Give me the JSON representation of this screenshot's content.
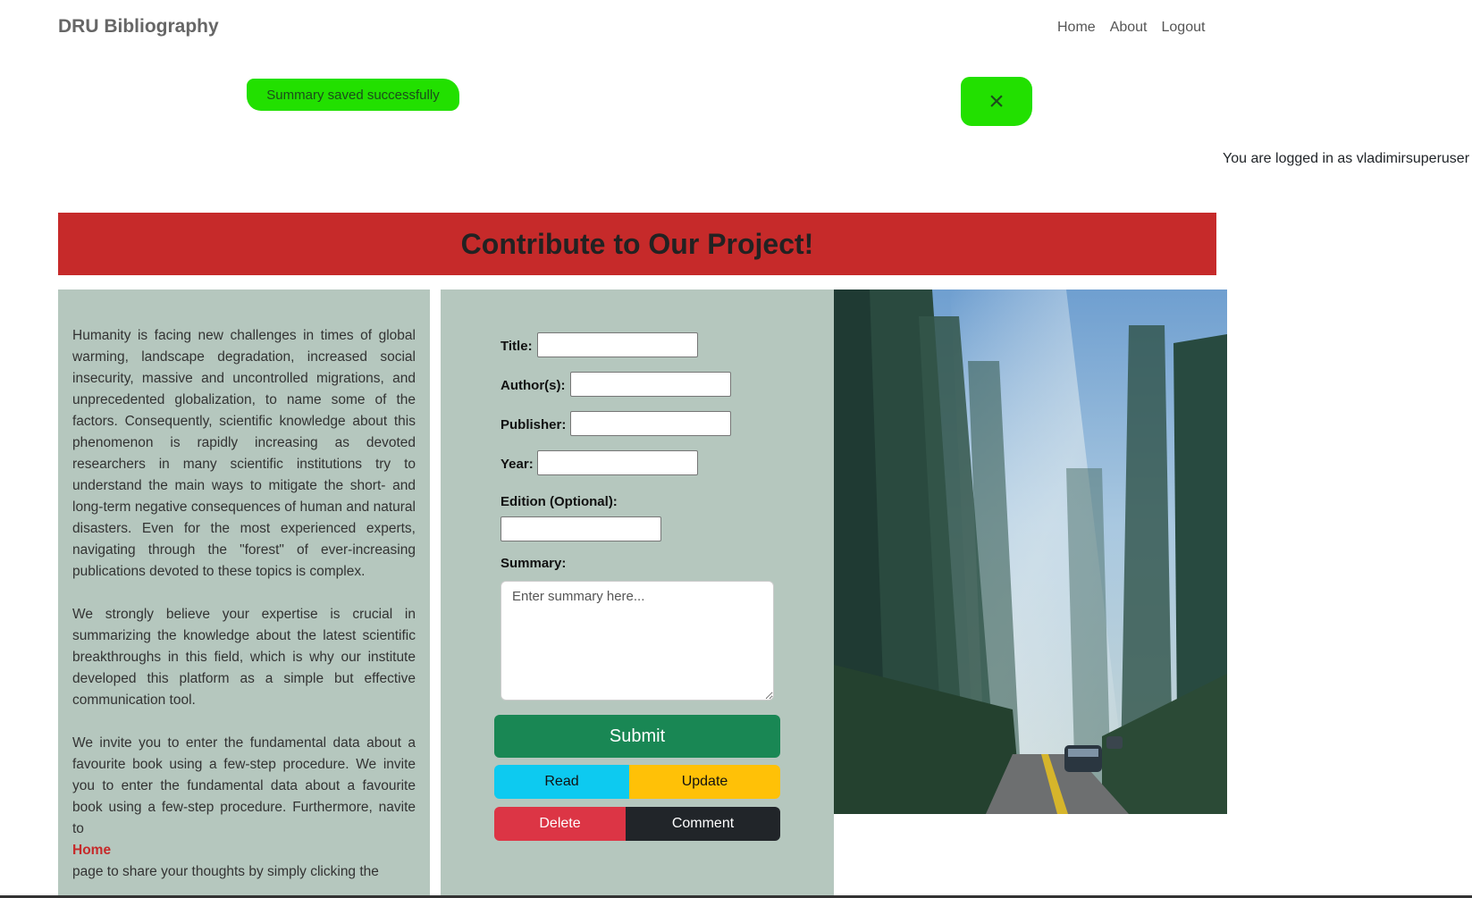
{
  "header": {
    "brand": "DRU Bibliography",
    "nav": [
      "Home",
      "About",
      "Logout"
    ]
  },
  "alert": {
    "message": "Summary saved successfully",
    "close_glyph": "×"
  },
  "login_status": "You are logged in as vladimirsuperuser",
  "banner": {
    "title": "Contribute to Our Project!",
    "color": "#c62a2a"
  },
  "intro": {
    "paragraphs": [
      "Humanity is facing new challenges in times of global warming, landscape degradation, increased social insecurity, massive and uncontrolled migrations, and unprecedented globalization, to name some of the factors. Consequently, scientific knowledge about this phenomenon is rapidly increasing as devoted researchers in many scientific institutions try to understand the main ways to mitigate the short- and long-term negative consequences of human and natural disasters. Even for the most experienced experts, navigating through the \"forest\" of ever-increasing publications devoted to these topics is complex.",
      "We strongly believe your expertise is crucial in summarizing the knowledge about the latest scientific breakthroughs in this field, which is why our institute developed this platform as a simple but effective communication tool.",
      "We invite you to enter the fundamental data about a favourite book using a few-step procedure. We invite you to enter the fundamental data about a favourite book using a few-step procedure. Furthermore, navite to"
    ],
    "home_link": "Home",
    "tail": "page to share your thoughts by simply clicking the"
  },
  "form": {
    "title_label": "Title:",
    "authors_label": "Author(s):",
    "publisher_label": "Publisher:",
    "year_label": "Year:",
    "edition_label": "Edition (Optional):",
    "summary_label": "Summary:",
    "summary_placeholder": "Enter summary here...",
    "title_value": "",
    "authors_value": "",
    "publisher_value": "",
    "year_value": "",
    "edition_value": ""
  },
  "buttons": {
    "submit": "Submit",
    "read": "Read",
    "update": "Update",
    "delete": "Delete",
    "comment": "Comment"
  },
  "image": {
    "subject": "smoky forest road with tall trees and cars"
  },
  "colors": {
    "panel_bg": "#b5c7be",
    "alert_highlight": "#22e000",
    "submit": "#198754",
    "read": "#0dcaf0",
    "update": "#ffc107",
    "delete": "#dc3545",
    "comment": "#212529"
  }
}
